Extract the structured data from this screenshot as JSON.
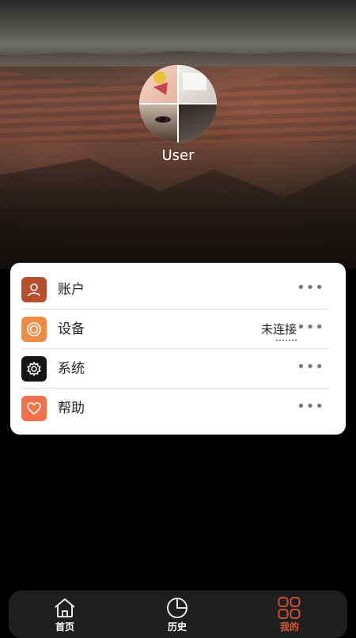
{
  "profile": {
    "username": "User"
  },
  "menu": {
    "items": [
      {
        "label": "账户",
        "icon": "user-icon",
        "color": "#B94E2E"
      },
      {
        "label": "设备",
        "icon": "device-icon",
        "color": "#F08B45",
        "status": "未连接"
      },
      {
        "label": "系统",
        "icon": "gear-icon",
        "color": "#141414"
      },
      {
        "label": "帮助",
        "icon": "heart-icon",
        "color": "#F2704A"
      }
    ],
    "more_glyph": "•••"
  },
  "tabbar": {
    "tabs": [
      {
        "label": "首页",
        "icon": "home-icon",
        "active": false
      },
      {
        "label": "历史",
        "icon": "pie-chart-icon",
        "active": false
      },
      {
        "label": "我的",
        "icon": "grid-icon",
        "active": true
      }
    ],
    "active_color": "#E2562D",
    "inactive_color": "#FFFFFF"
  }
}
